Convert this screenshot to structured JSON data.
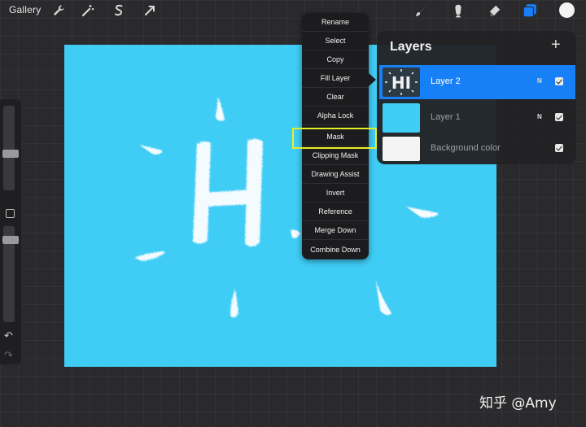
{
  "toolbar": {
    "gallery_label": "Gallery",
    "left_tools": [
      "wrench-icon",
      "magic-wand-icon",
      "selection-icon",
      "transform-arrow-icon"
    ],
    "right_tools": [
      "brush-icon",
      "smudge-icon",
      "eraser-icon",
      "layers-icon"
    ],
    "current_color": "#f4f4f4",
    "accent": "#1880f6"
  },
  "layer_menu": {
    "items": [
      "Rename",
      "Select",
      "Copy",
      "Fill Layer",
      "Clear",
      "Alpha Lock",
      "Mask",
      "Clipping Mask",
      "Drawing Assist",
      "Invert",
      "Reference",
      "Merge Down",
      "Combine Down"
    ],
    "highlighted_item": "Mask",
    "highlight_color": "#e6ee2a"
  },
  "layers_panel": {
    "title": "Layers",
    "add_symbol": "+",
    "layers": [
      {
        "name": "Layer 2",
        "blend_mode": "N",
        "visible": true,
        "active": true,
        "thumb_text": "HI"
      },
      {
        "name": "Layer 1",
        "blend_mode": "N",
        "visible": true,
        "active": false
      },
      {
        "name": "Background color",
        "visible": true,
        "active": false
      }
    ]
  },
  "canvas": {
    "background": "#3fcdf6",
    "artwork_text": "H"
  },
  "watermark": "知乎 @Amy"
}
